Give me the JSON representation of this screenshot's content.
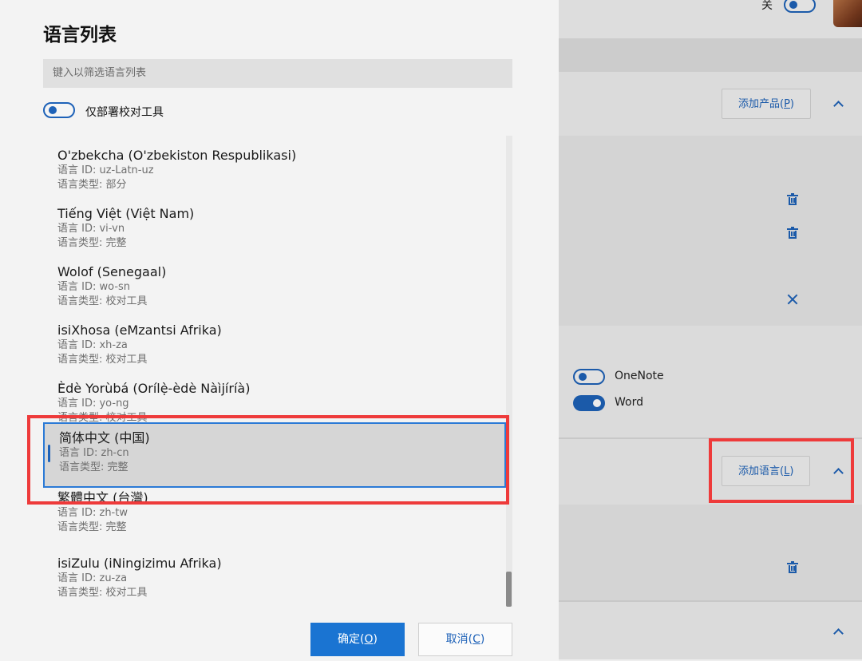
{
  "background": {
    "top_toggle_label": "关",
    "add_product_label": "添加产品(",
    "add_product_key": "P",
    "add_product_close": ")",
    "add_language_label": "添加语言(",
    "add_language_key": "L",
    "add_language_close": ")",
    "apps": [
      {
        "name": "OneNote",
        "state": "off"
      },
      {
        "name": "Word",
        "state": "on"
      }
    ]
  },
  "dialog": {
    "title": "语言列表",
    "filter_placeholder": "键入以筛选语言列表",
    "proofing_toggle_label": "仅部署校对工具",
    "languages": [
      {
        "name": "O'zbekcha (O'zbekiston Respublikasi)",
        "id": "语言 ID: uz-Latn-uz",
        "type": "语言类型: 部分"
      },
      {
        "name": "Tiếng Việt (Việt Nam)",
        "id": "语言 ID: vi-vn",
        "type": "语言类型: 完整"
      },
      {
        "name": "Wolof (Senegaal)",
        "id": "语言 ID: wo-sn",
        "type": "语言类型: 校对工具"
      },
      {
        "name": "isiXhosa (eMzantsi Afrika)",
        "id": "语言 ID: xh-za",
        "type": "语言类型: 校对工具"
      },
      {
        "name": "Èdè Yorùbá (Orílẹ̀-èdè Nàìjíríà)",
        "id": "语言 ID: yo-ng",
        "type": "语言类型: 校对工具"
      },
      {
        "name": "简体中文 (中国)",
        "id": "语言 ID: zh-cn",
        "type": "语言类型: 完整",
        "selected": true
      },
      {
        "name": "繁體中文 (台灣)",
        "id": "语言 ID: zh-tw",
        "type": "语言类型: 完整"
      },
      {
        "name": "isiZulu (iNingizimu Afrika)",
        "id": "语言 ID: zu-za",
        "type": "语言类型: 校对工具"
      }
    ],
    "ok_label": "确定(",
    "ok_key": "O",
    "ok_close": ")",
    "cancel_label": "取消(",
    "cancel_key": "C",
    "cancel_close": ")"
  },
  "colors": {
    "accent": "#1e62b8",
    "primary_button": "#1a74d2",
    "annotation": "#ee3a3a"
  }
}
